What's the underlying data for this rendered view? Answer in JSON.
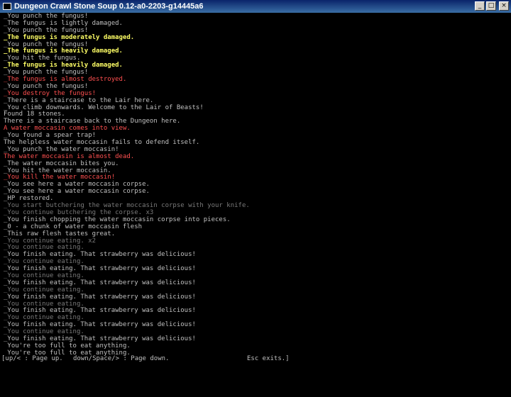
{
  "window": {
    "title": "Dungeon Crawl Stone Soup 0.12-a0-2203-g14445a6",
    "controls": {
      "minimize": "_",
      "maximize": "□",
      "close": "×"
    }
  },
  "log": [
    {
      "text": "_You punch the fungus!",
      "color": "white"
    },
    {
      "text": "_The fungus is lightly damaged.",
      "color": "white"
    },
    {
      "text": "_You punch the fungus!",
      "color": "white"
    },
    {
      "text": "_The fungus is moderately damaged.",
      "color": "yellow"
    },
    {
      "text": "_You punch the fungus!",
      "color": "white"
    },
    {
      "text": "_The fungus is heavily damaged.",
      "color": "yellow"
    },
    {
      "text": "_You hit the fungus.",
      "color": "white"
    },
    {
      "text": "_The fungus is heavily damaged.",
      "color": "yellow"
    },
    {
      "text": "_You punch the fungus!",
      "color": "white"
    },
    {
      "text": "_The fungus is almost destroyed.",
      "color": "red"
    },
    {
      "text": "_You punch the fungus!",
      "color": "white"
    },
    {
      "text": "_You destroy the fungus!",
      "color": "red"
    },
    {
      "text": "_There is a staircase to the Lair here.",
      "color": "white"
    },
    {
      "text": "_You climb downwards. Welcome to the Lair of Beasts!",
      "color": "white"
    },
    {
      "text": "Found 18 stones.",
      "color": "white"
    },
    {
      "text": "There is a staircase back to the Dungeon here.",
      "color": "white"
    },
    {
      "text": "A water moccasin comes into view.",
      "color": "red"
    },
    {
      "text": "_You found a spear trap!",
      "color": "white"
    },
    {
      "text": "The helpless water moccasin fails to defend itself.",
      "color": "white"
    },
    {
      "text": "_You punch the water moccasin!",
      "color": "white"
    },
    {
      "text": "The water moccasin is almost dead.",
      "color": "red"
    },
    {
      "text": "_The water moccasin bites you.",
      "color": "white"
    },
    {
      "text": "_You hit the water moccasin.",
      "color": "white"
    },
    {
      "text": "_You kill the water moccasin!",
      "color": "red"
    },
    {
      "text": "_You see here a water moccasin corpse.",
      "color": "white"
    },
    {
      "text": "_You see here a water moccasin corpse.",
      "color": "white"
    },
    {
      "text": "_HP restored.",
      "color": "white"
    },
    {
      "text": "_You start butchering the water moccasin corpse with your knife.",
      "color": "gray"
    },
    {
      "text": "_You continue butchering the corpse. x3",
      "color": "gray"
    },
    {
      "text": "_You finish chopping the water moccasin corpse into pieces.",
      "color": "white"
    },
    {
      "text": "_0 - a chunk of water moccasin flesh",
      "color": "white"
    },
    {
      "text": "_This raw flesh tastes great.",
      "color": "white"
    },
    {
      "text": "_You continue eating. x2",
      "color": "gray"
    },
    {
      "text": "_You continue eating.",
      "color": "gray"
    },
    {
      "text": "_You finish eating. That strawberry was delicious!",
      "color": "white"
    },
    {
      "text": "_You continue eating.",
      "color": "gray"
    },
    {
      "text": "_You finish eating. That strawberry was delicious!",
      "color": "white"
    },
    {
      "text": "_You continue eating.",
      "color": "gray"
    },
    {
      "text": "_You finish eating. That strawberry was delicious!",
      "color": "white"
    },
    {
      "text": "_You continue eating.",
      "color": "gray"
    },
    {
      "text": "_You finish eating. That strawberry was delicious!",
      "color": "white"
    },
    {
      "text": "_You continue eating.",
      "color": "gray"
    },
    {
      "text": "_You finish eating. That strawberry was delicious!",
      "color": "white"
    },
    {
      "text": "_You continue eating.",
      "color": "gray"
    },
    {
      "text": "_You finish eating. That strawberry was delicious!",
      "color": "white"
    },
    {
      "text": "_You continue eating.",
      "color": "gray"
    },
    {
      "text": "_You finish eating. That strawberry was delicious!",
      "color": "white"
    },
    {
      "text": " You're too full to eat anything.",
      "color": "white"
    },
    {
      "text": " You're too full to eat anything.",
      "color": "white"
    }
  ],
  "footer": {
    "page_up": "[up/< : Page up.",
    "page_down": "down/Space/> : Page down.",
    "esc": "Esc exits.]"
  },
  "colors": {
    "white": "#c0c0c0",
    "yellow": "#ffff66",
    "red": "#ff5050",
    "gray": "#7a7a7a",
    "background": "#000000"
  }
}
